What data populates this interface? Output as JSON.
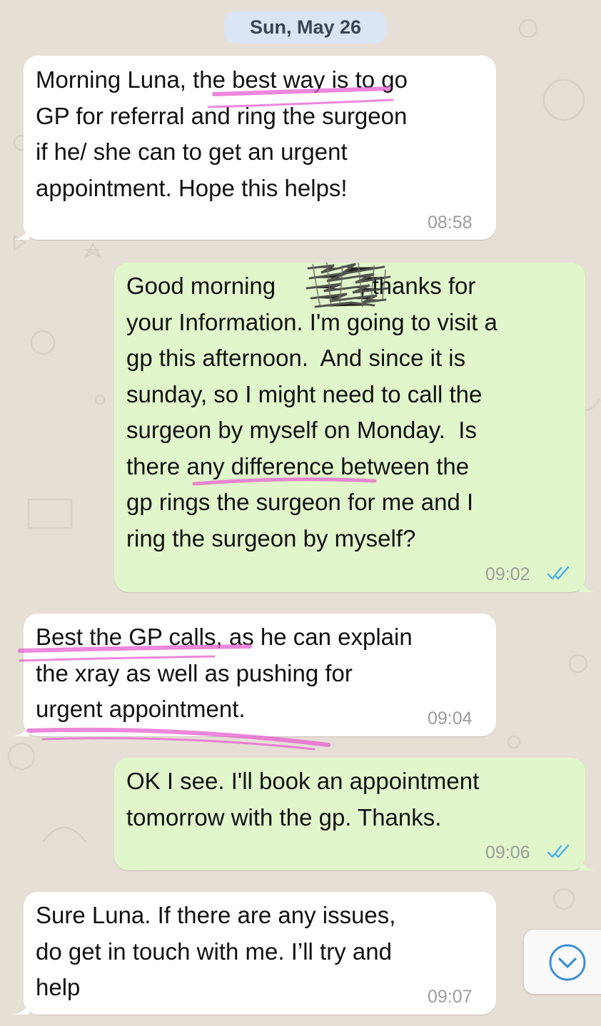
{
  "date_separator": "Sun, May 26",
  "messages": [
    {
      "direction": "incoming",
      "lines": [
        "Morning Luna, the best way is to go",
        "GP for referral and ring the surgeon",
        "if he/ she can to get an urgent",
        "appointment. Hope this helps!"
      ],
      "time": "08:58"
    },
    {
      "direction": "outgoing",
      "lines": [
        "Good morning",
        "your Information. I'm going to visit a",
        "gp this afternoon.  And since it is",
        "sunday, so I might need to call the",
        "surgeon by myself on Monday.  Is",
        "there any difference between the",
        "gp rings the surgeon for me and I",
        "ring the surgeon by myself?"
      ],
      "line1_after_redaction": ", thanks for",
      "time": "09:02",
      "status": "read-double-tick-icon"
    },
    {
      "direction": "incoming",
      "lines": [
        "Best the GP calls, as he can explain",
        "the xray as well as pushing for",
        "urgent appointment."
      ],
      "time": "09:04"
    },
    {
      "direction": "outgoing",
      "lines": [
        "OK I see. I'll book an appointment",
        "tomorrow with the gp. Thanks."
      ],
      "time": "09:06",
      "status": "read-double-tick-icon"
    },
    {
      "direction": "incoming",
      "lines": [
        "Sure Luna. If there are any issues,",
        "do get in touch with me. I’ll try and",
        "help"
      ],
      "time": "09:07"
    }
  ],
  "scroll_down_button": {
    "icon": "chevron-down-circle-icon"
  },
  "colors": {
    "wallpaper": "#e6dfd5",
    "incoming_bubble": "#ffffff",
    "outgoing_bubble": "#e1f7cb",
    "date_pill": "#d9e4f5",
    "read_ticks": "#4fb6ec",
    "highlighter": "#e85fd0"
  }
}
